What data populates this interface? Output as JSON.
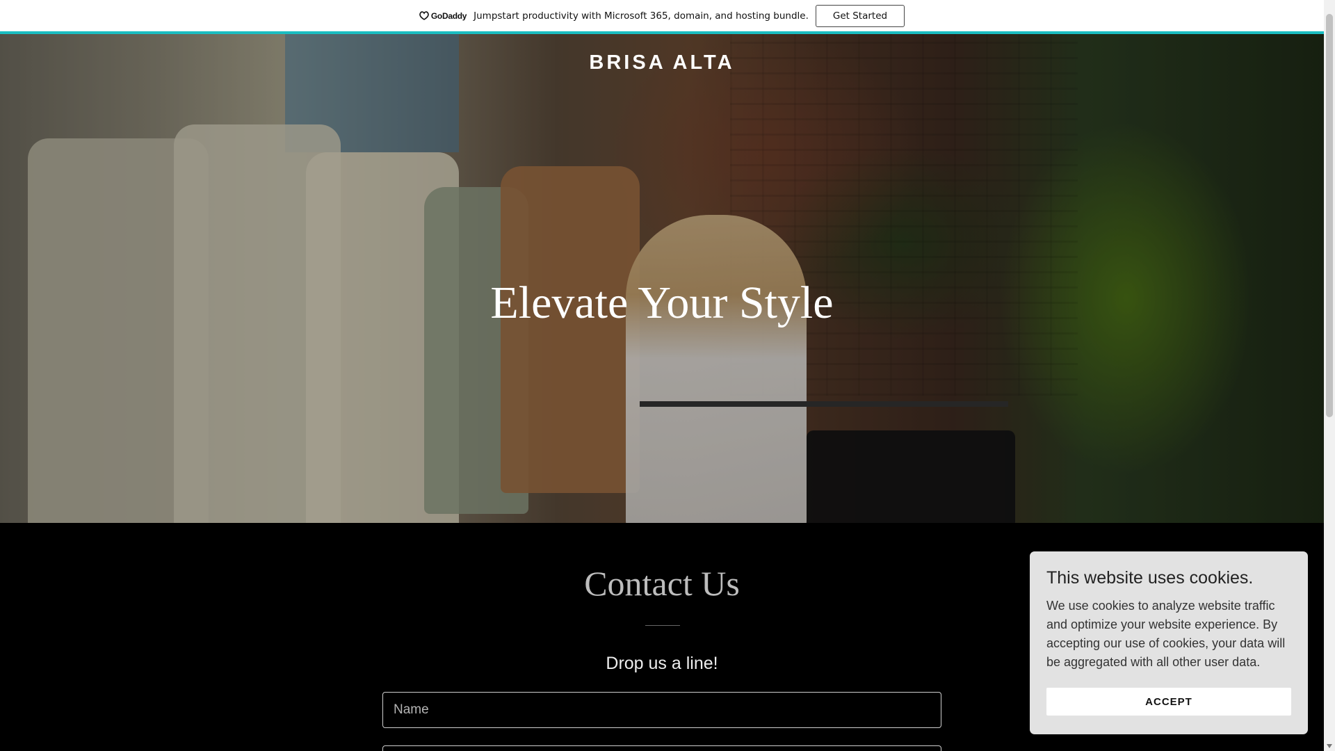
{
  "promo": {
    "logo_text": "GoDaddy",
    "message": "Jumpstart productivity with Microsoft 365, domain, and hosting bundle.",
    "button_label": "Get Started"
  },
  "site": {
    "brand": "BRISA ALTA"
  },
  "hero": {
    "title": "Elevate Your Style"
  },
  "contact": {
    "title": "Contact Us",
    "subtitle": "Drop us a line!",
    "name_placeholder": "Name",
    "email_placeholder": ""
  },
  "cookie": {
    "title": "This website uses cookies.",
    "body": "We use cookies to analyze website traffic and optimize your website experience. By accepting our use of cookies, your data will be aggregated with all other user data.",
    "accept_label": "ACCEPT"
  },
  "colors": {
    "promo_border": "#1bbdc1",
    "page_background": "#000000",
    "cookie_background": "#e2e2e2"
  }
}
